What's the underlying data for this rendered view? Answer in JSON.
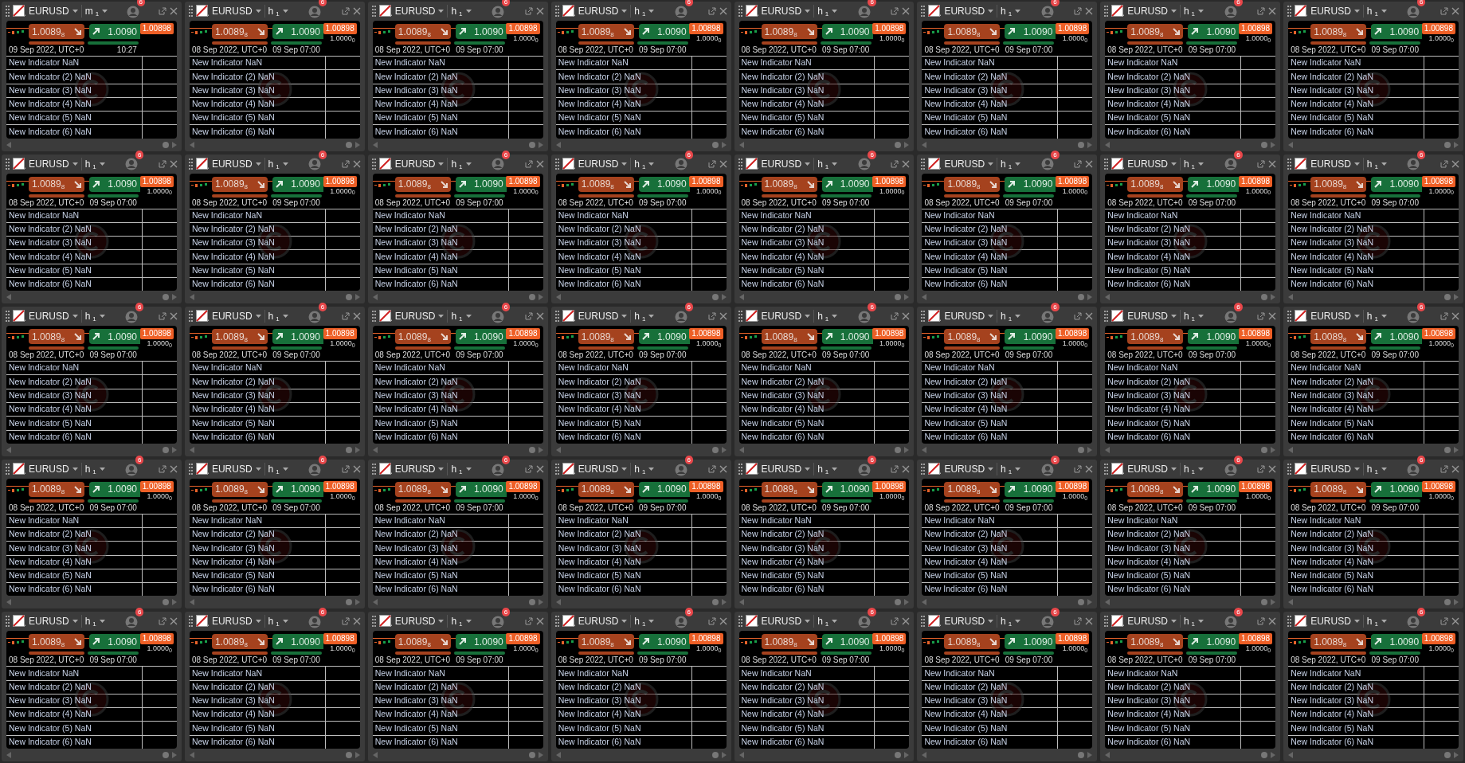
{
  "panels": [
    {
      "symbol": "EURUSD",
      "tf_unit": "m",
      "tf_count": "1",
      "alerts": "6",
      "sell": "1.0089$_{8}$",
      "buy": "1.0090",
      "price_tag": "1.00898",
      "date": "09 Sep 2022, UTC+0",
      "time": "10:27",
      "indicators": [
        "New Indicator NaN",
        "New Indicator (2) NaN",
        "New Indicator (3) NaN",
        "New Indicator (4) NaN",
        "New Indicator (5) NaN",
        "New Indicator (6) NaN"
      ]
    },
    {
      "symbol": "EURUSD",
      "tf_unit": "h",
      "tf_count": "1",
      "alerts": "6",
      "sell": "1.0089$_{8}$",
      "buy": "1.0090",
      "price_tag": "1.00898",
      "axis_label": "1.0000$_{0}$",
      "date": "08 Sep 2022, UTC+0",
      "time": "09 Sep 07:00",
      "indicators": [
        "New Indicator NaN",
        "New Indicator (2) NaN",
        "New Indicator (3) NaN",
        "New Indicator (4) NaN",
        "New Indicator (5) NaN",
        "New Indicator (6) NaN"
      ]
    },
    {
      "symbol": "EURUSD",
      "tf_unit": "h",
      "tf_count": "1",
      "alerts": "6",
      "sell": "1.0089$_{8}$",
      "buy": "1.0090",
      "price_tag": "1.00898",
      "axis_label": "1.0000$_{0}$",
      "date": "08 Sep 2022, UTC+0",
      "time": "09 Sep 07:00",
      "indicators": [
        "New Indicator NaN",
        "New Indicator (2) NaN",
        "New Indicator (3) NaN",
        "New Indicator (4) NaN",
        "New Indicator (5) NaN",
        "New Indicator (6) NaN"
      ]
    },
    {
      "symbol": "EURUSD",
      "tf_unit": "h",
      "tf_count": "1",
      "alerts": "6",
      "sell": "1.0089$_{8}$",
      "buy": "1.0090",
      "price_tag": "1.00898",
      "axis_label": "1.0000$_{0}$",
      "date": "08 Sep 2022, UTC+0",
      "time": "09 Sep 07:00",
      "indicators": [
        "New Indicator NaN",
        "New Indicator (2) NaN",
        "New Indicator (3) NaN",
        "New Indicator (4) NaN",
        "New Indicator (5) NaN",
        "New Indicator (6) NaN"
      ]
    },
    {
      "symbol": "EURUSD",
      "tf_unit": "h",
      "tf_count": "1",
      "alerts": "6",
      "sell": "1.0089$_{8}$",
      "buy": "1.0090",
      "price_tag": "1.00898",
      "axis_label": "1.0000$_{0}$",
      "date": "08 Sep 2022, UTC+0",
      "time": "09 Sep 07:00",
      "indicators": [
        "New Indicator NaN",
        "New Indicator (2) NaN",
        "New Indicator (3) NaN",
        "New Indicator (4) NaN",
        "New Indicator (5) NaN",
        "New Indicator (6) NaN"
      ]
    },
    {
      "symbol": "EURUSD",
      "tf_unit": "h",
      "tf_count": "1",
      "alerts": "6",
      "sell": "1.0089$_{8}$",
      "buy": "1.0090",
      "price_tag": "1.00898",
      "axis_label": "1.0000$_{0}$",
      "date": "08 Sep 2022, UTC+0",
      "time": "09 Sep 07:00",
      "indicators": [
        "New Indicator NaN",
        "New Indicator (2) NaN",
        "New Indicator (3) NaN",
        "New Indicator (4) NaN",
        "New Indicator (5) NaN",
        "New Indicator (6) NaN"
      ]
    },
    {
      "symbol": "EURUSD",
      "tf_unit": "h",
      "tf_count": "1",
      "alerts": "6",
      "sell": "1.0089$_{8}$",
      "buy": "1.0090",
      "price_tag": "1.00898",
      "axis_label": "1.0000$_{0}$",
      "date": "08 Sep 2022, UTC+0",
      "time": "09 Sep 07:00",
      "indicators": [
        "New Indicator NaN",
        "New Indicator (2) NaN",
        "New Indicator (3) NaN",
        "New Indicator (4) NaN",
        "New Indicator (5) NaN",
        "New Indicator (6) NaN"
      ]
    },
    {
      "symbol": "EURUSD",
      "tf_unit": "h",
      "tf_count": "1",
      "alerts": "6",
      "sell": "1.0089$_{8}$",
      "buy": "1.0090",
      "price_tag": "1.00898",
      "axis_label": "1.0000$_{0}$",
      "date": "08 Sep 2022, UTC+0",
      "time": "09 Sep 07:00",
      "indicators": [
        "New Indicator NaN",
        "New Indicator (2) NaN",
        "New Indicator (3) NaN",
        "New Indicator (4) NaN",
        "New Indicator (5) NaN",
        "New Indicator (6) NaN"
      ]
    },
    {
      "symbol": "EURUSD",
      "tf_unit": "h",
      "tf_count": "1",
      "alerts": "6",
      "sell": "1.0089$_{8}$",
      "buy": "1.0090",
      "price_tag": "1.00898",
      "axis_label": "1.0000$_{0}$",
      "date": "08 Sep 2022, UTC+0",
      "time": "09 Sep 07:00",
      "indicators": [
        "New Indicator NaN",
        "New Indicator (2) NaN",
        "New Indicator (3) NaN",
        "New Indicator (4) NaN",
        "New Indicator (5) NaN",
        "New Indicator (6) NaN"
      ]
    },
    {
      "symbol": "EURUSD",
      "tf_unit": "h",
      "tf_count": "1",
      "alerts": "6",
      "sell": "1.0089$_{8}$",
      "buy": "1.0090",
      "price_tag": "1.00898",
      "axis_label": "1.0000$_{0}$",
      "date": "08 Sep 2022, UTC+0",
      "time": "09 Sep 07:00",
      "indicators": [
        "New Indicator NaN",
        "New Indicator (2) NaN",
        "New Indicator (3) NaN",
        "New Indicator (4) NaN",
        "New Indicator (5) NaN",
        "New Indicator (6) NaN"
      ]
    },
    {
      "symbol": "EURUSD",
      "tf_unit": "h",
      "tf_count": "1",
      "alerts": "6",
      "sell": "1.0089$_{8}$",
      "buy": "1.0090",
      "price_tag": "1.00898",
      "axis_label": "1.0000$_{0}$",
      "date": "08 Sep 2022, UTC+0",
      "time": "09 Sep 07:00",
      "indicators": [
        "New Indicator NaN",
        "New Indicator (2) NaN",
        "New Indicator (3) NaN",
        "New Indicator (4) NaN",
        "New Indicator (5) NaN",
        "New Indicator (6) NaN"
      ]
    },
    {
      "symbol": "EURUSD",
      "tf_unit": "h",
      "tf_count": "1",
      "alerts": "6",
      "sell": "1.0089$_{8}$",
      "buy": "1.0090",
      "price_tag": "1.00898",
      "axis_label": "1.0000$_{0}$",
      "date": "08 Sep 2022, UTC+0",
      "time": "09 Sep 07:00",
      "indicators": [
        "New Indicator NaN",
        "New Indicator (2) NaN",
        "New Indicator (3) NaN",
        "New Indicator (4) NaN",
        "New Indicator (5) NaN",
        "New Indicator (6) NaN"
      ]
    },
    {
      "symbol": "EURUSD",
      "tf_unit": "h",
      "tf_count": "1",
      "alerts": "6",
      "sell": "1.0089$_{8}$",
      "buy": "1.0090",
      "price_tag": "1.00898",
      "axis_label": "1.0000$_{0}$",
      "date": "08 Sep 2022, UTC+0",
      "time": "09 Sep 07:00",
      "indicators": [
        "New Indicator NaN",
        "New Indicator (2) NaN",
        "New Indicator (3) NaN",
        "New Indicator (4) NaN",
        "New Indicator (5) NaN",
        "New Indicator (6) NaN"
      ]
    },
    {
      "symbol": "EURUSD",
      "tf_unit": "h",
      "tf_count": "1",
      "alerts": "6",
      "sell": "1.0089$_{8}$",
      "buy": "1.0090",
      "price_tag": "1.00898",
      "axis_label": "1.0000$_{0}$",
      "date": "08 Sep 2022, UTC+0",
      "time": "09 Sep 07:00",
      "indicators": [
        "New Indicator NaN",
        "New Indicator (2) NaN",
        "New Indicator (3) NaN",
        "New Indicator (4) NaN",
        "New Indicator (5) NaN",
        "New Indicator (6) NaN"
      ]
    },
    {
      "symbol": "EURUSD",
      "tf_unit": "h",
      "tf_count": "1",
      "alerts": "6",
      "sell": "1.0089$_{8}$",
      "buy": "1.0090",
      "price_tag": "1.00898",
      "axis_label": "1.0000$_{0}$",
      "date": "08 Sep 2022, UTC+0",
      "time": "09 Sep 07:00",
      "indicators": [
        "New Indicator NaN",
        "New Indicator (2) NaN",
        "New Indicator (3) NaN",
        "New Indicator (4) NaN",
        "New Indicator (5) NaN",
        "New Indicator (6) NaN"
      ]
    },
    {
      "symbol": "EURUSD",
      "tf_unit": "h",
      "tf_count": "1",
      "alerts": "6",
      "sell": "1.0089$_{8}$",
      "buy": "1.0090",
      "price_tag": "1.00898",
      "axis_label": "1.0000$_{0}$",
      "date": "08 Sep 2022, UTC+0",
      "time": "09 Sep 07:00",
      "indicators": [
        "New Indicator NaN",
        "New Indicator (2) NaN",
        "New Indicator (3) NaN",
        "New Indicator (4) NaN",
        "New Indicator (5) NaN",
        "New Indicator (6) NaN"
      ]
    },
    {
      "symbol": "EURUSD",
      "tf_unit": "h",
      "tf_count": "1",
      "alerts": "6",
      "sell": "1.0089$_{8}$",
      "buy": "1.0090",
      "price_tag": "1.00898",
      "axis_label": "1.0000$_{0}$",
      "date": "08 Sep 2022, UTC+0",
      "time": "09 Sep 07:00",
      "indicators": [
        "New Indicator NaN",
        "New Indicator (2) NaN",
        "New Indicator (3) NaN",
        "New Indicator (4) NaN",
        "New Indicator (5) NaN",
        "New Indicator (6) NaN"
      ]
    },
    {
      "symbol": "EURUSD",
      "tf_unit": "h",
      "tf_count": "1",
      "alerts": "6",
      "sell": "1.0089$_{8}$",
      "buy": "1.0090",
      "price_tag": "1.00898",
      "axis_label": "1.0000$_{0}$",
      "date": "08 Sep 2022, UTC+0",
      "time": "09 Sep 07:00",
      "indicators": [
        "New Indicator NaN",
        "New Indicator (2) NaN",
        "New Indicator (3) NaN",
        "New Indicator (4) NaN",
        "New Indicator (5) NaN",
        "New Indicator (6) NaN"
      ]
    },
    {
      "symbol": "EURUSD",
      "tf_unit": "h",
      "tf_count": "1",
      "alerts": "6",
      "sell": "1.0089$_{8}$",
      "buy": "1.0090",
      "price_tag": "1.00898",
      "axis_label": "1.0000$_{0}$",
      "date": "08 Sep 2022, UTC+0",
      "time": "09 Sep 07:00",
      "indicators": [
        "New Indicator NaN",
        "New Indicator (2) NaN",
        "New Indicator (3) NaN",
        "New Indicator (4) NaN",
        "New Indicator (5) NaN",
        "New Indicator (6) NaN"
      ]
    },
    {
      "symbol": "EURUSD",
      "tf_unit": "h",
      "tf_count": "1",
      "alerts": "6",
      "sell": "1.0089$_{8}$",
      "buy": "1.0090",
      "price_tag": "1.00898",
      "axis_label": "1.0000$_{0}$",
      "date": "08 Sep 2022, UTC+0",
      "time": "09 Sep 07:00",
      "indicators": [
        "New Indicator NaN",
        "New Indicator (2) NaN",
        "New Indicator (3) NaN",
        "New Indicator (4) NaN",
        "New Indicator (5) NaN",
        "New Indicator (6) NaN"
      ]
    },
    {
      "symbol": "EURUSD",
      "tf_unit": "h",
      "tf_count": "1",
      "alerts": "6",
      "sell": "1.0089$_{8}$",
      "buy": "1.0090",
      "price_tag": "1.00898",
      "axis_label": "1.0000$_{0}$",
      "date": "08 Sep 2022, UTC+0",
      "time": "09 Sep 07:00",
      "indicators": [
        "New Indicator NaN",
        "New Indicator (2) NaN",
        "New Indicator (3) NaN",
        "New Indicator (4) NaN",
        "New Indicator (5) NaN",
        "New Indicator (6) NaN"
      ]
    },
    {
      "symbol": "EURUSD",
      "tf_unit": "h",
      "tf_count": "1",
      "alerts": "6",
      "sell": "1.0089$_{8}$",
      "buy": "1.0090",
      "price_tag": "1.00898",
      "axis_label": "1.0000$_{0}$",
      "date": "08 Sep 2022, UTC+0",
      "time": "09 Sep 07:00",
      "indicators": [
        "New Indicator NaN",
        "New Indicator (2) NaN",
        "New Indicator (3) NaN",
        "New Indicator (4) NaN",
        "New Indicator (5) NaN",
        "New Indicator (6) NaN"
      ]
    },
    {
      "symbol": "EURUSD",
      "tf_unit": "h",
      "tf_count": "1",
      "alerts": "6",
      "sell": "1.0089$_{8}$",
      "buy": "1.0090",
      "price_tag": "1.00898",
      "axis_label": "1.0000$_{0}$",
      "date": "08 Sep 2022, UTC+0",
      "time": "09 Sep 07:00",
      "indicators": [
        "New Indicator NaN",
        "New Indicator (2) NaN",
        "New Indicator (3) NaN",
        "New Indicator (4) NaN",
        "New Indicator (5) NaN",
        "New Indicator (6) NaN"
      ]
    },
    {
      "symbol": "EURUSD",
      "tf_unit": "h",
      "tf_count": "1",
      "alerts": "6",
      "sell": "1.0089$_{8}$",
      "buy": "1.0090",
      "price_tag": "1.00898",
      "axis_label": "1.0000$_{0}$",
      "date": "08 Sep 2022, UTC+0",
      "time": "09 Sep 07:00",
      "indicators": [
        "New Indicator NaN",
        "New Indicator (2) NaN",
        "New Indicator (3) NaN",
        "New Indicator (4) NaN",
        "New Indicator (5) NaN",
        "New Indicator (6) NaN"
      ]
    },
    {
      "symbol": "EURUSD",
      "tf_unit": "h",
      "tf_count": "1",
      "alerts": "6",
      "sell": "1.0089$_{8}$",
      "buy": "1.0090",
      "price_tag": "1.00898",
      "axis_label": "1.0000$_{0}$",
      "date": "08 Sep 2022, UTC+0",
      "time": "09 Sep 07:00",
      "indicators": [
        "New Indicator NaN",
        "New Indicator (2) NaN",
        "New Indicator (3) NaN",
        "New Indicator (4) NaN",
        "New Indicator (5) NaN",
        "New Indicator (6) NaN"
      ]
    },
    {
      "symbol": "EURUSD",
      "tf_unit": "h",
      "tf_count": "1",
      "alerts": "6",
      "sell": "1.0089$_{8}$",
      "buy": "1.0090",
      "price_tag": "1.00898",
      "axis_label": "1.0000$_{0}$",
      "date": "08 Sep 2022, UTC+0",
      "time": "09 Sep 07:00",
      "indicators": [
        "New Indicator NaN",
        "New Indicator (2) NaN",
        "New Indicator (3) NaN",
        "New Indicator (4) NaN",
        "New Indicator (5) NaN",
        "New Indicator (6) NaN"
      ]
    },
    {
      "symbol": "EURUSD",
      "tf_unit": "h",
      "tf_count": "1",
      "alerts": "6",
      "sell": "1.0089$_{8}$",
      "buy": "1.0090",
      "price_tag": "1.00898",
      "axis_label": "1.0000$_{0}$",
      "date": "08 Sep 2022, UTC+0",
      "time": "09 Sep 07:00",
      "indicators": [
        "New Indicator NaN",
        "New Indicator (2) NaN",
        "New Indicator (3) NaN",
        "New Indicator (4) NaN",
        "New Indicator (5) NaN",
        "New Indicator (6) NaN"
      ]
    },
    {
      "symbol": "EURUSD",
      "tf_unit": "h",
      "tf_count": "1",
      "alerts": "6",
      "sell": "1.0089$_{8}$",
      "buy": "1.0090",
      "price_tag": "1.00898",
      "axis_label": "1.0000$_{0}$",
      "date": "08 Sep 2022, UTC+0",
      "time": "09 Sep 07:00",
      "indicators": [
        "New Indicator NaN",
        "New Indicator (2) NaN",
        "New Indicator (3) NaN",
        "New Indicator (4) NaN",
        "New Indicator (5) NaN",
        "New Indicator (6) NaN"
      ]
    },
    {
      "symbol": "EURUSD",
      "tf_unit": "h",
      "tf_count": "1",
      "alerts": "6",
      "sell": "1.0089$_{8}$",
      "buy": "1.0090",
      "price_tag": "1.00898",
      "axis_label": "1.0000$_{0}$",
      "date": "08 Sep 2022, UTC+0",
      "time": "09 Sep 07:00",
      "indicators": [
        "New Indicator NaN",
        "New Indicator (2) NaN",
        "New Indicator (3) NaN",
        "New Indicator (4) NaN",
        "New Indicator (5) NaN",
        "New Indicator (6) NaN"
      ]
    },
    {
      "symbol": "EURUSD",
      "tf_unit": "h",
      "tf_count": "1",
      "alerts": "6",
      "sell": "1.0089$_{8}$",
      "buy": "1.0090",
      "price_tag": "1.00898",
      "axis_label": "1.0000$_{0}$",
      "date": "08 Sep 2022, UTC+0",
      "time": "09 Sep 07:00",
      "indicators": [
        "New Indicator NaN",
        "New Indicator (2) NaN",
        "New Indicator (3) NaN",
        "New Indicator (4) NaN",
        "New Indicator (5) NaN",
        "New Indicator (6) NaN"
      ]
    },
    {
      "symbol": "EURUSD",
      "tf_unit": "h",
      "tf_count": "1",
      "alerts": "6",
      "sell": "1.0089$_{8}$",
      "buy": "1.0090",
      "price_tag": "1.00898",
      "axis_label": "1.0000$_{0}$",
      "date": "08 Sep 2022, UTC+0",
      "time": "09 Sep 07:00",
      "indicators": [
        "New Indicator NaN",
        "New Indicator (2) NaN",
        "New Indicator (3) NaN",
        "New Indicator (4) NaN",
        "New Indicator (5) NaN",
        "New Indicator (6) NaN"
      ]
    },
    {
      "symbol": "EURUSD",
      "tf_unit": "h",
      "tf_count": "1",
      "alerts": "6",
      "sell": "1.0089$_{8}$",
      "buy": "1.0090",
      "price_tag": "1.00898",
      "axis_label": "1.0000$_{0}$",
      "date": "08 Sep 2022, UTC+0",
      "time": "09 Sep 07:00",
      "indicators": [
        "New Indicator NaN",
        "New Indicator (2) NaN",
        "New Indicator (3) NaN",
        "New Indicator (4) NaN",
        "New Indicator (5) NaN",
        "New Indicator (6) NaN"
      ]
    },
    {
      "symbol": "EURUSD",
      "tf_unit": "h",
      "tf_count": "1",
      "alerts": "6",
      "sell": "1.0089$_{8}$",
      "buy": "1.0090",
      "price_tag": "1.00898",
      "axis_label": "1.0000$_{0}$",
      "date": "08 Sep 2022, UTC+0",
      "time": "09 Sep 07:00",
      "indicators": [
        "New Indicator NaN",
        "New Indicator (2) NaN",
        "New Indicator (3) NaN",
        "New Indicator (4) NaN",
        "New Indicator (5) NaN",
        "New Indicator (6) NaN"
      ]
    },
    {
      "symbol": "EURUSD",
      "tf_unit": "h",
      "tf_count": "1",
      "alerts": "6",
      "sell": "1.0089$_{8}$",
      "buy": "1.0090",
      "price_tag": "1.00898",
      "axis_label": "1.0000$_{0}$",
      "date": "08 Sep 2022, UTC+0",
      "time": "09 Sep 07:00",
      "indicators": [
        "New Indicator NaN",
        "New Indicator (2) NaN",
        "New Indicator (3) NaN",
        "New Indicator (4) NaN",
        "New Indicator (5) NaN",
        "New Indicator (6) NaN"
      ]
    },
    {
      "symbol": "EURUSD",
      "tf_unit": "h",
      "tf_count": "1",
      "alerts": "6",
      "sell": "1.0089$_{8}$",
      "buy": "1.0090",
      "price_tag": "1.00898",
      "axis_label": "1.0000$_{0}$",
      "date": "08 Sep 2022, UTC+0",
      "time": "09 Sep 07:00",
      "indicators": [
        "New Indicator NaN",
        "New Indicator (2) NaN",
        "New Indicator (3) NaN",
        "New Indicator (4) NaN",
        "New Indicator (5) NaN",
        "New Indicator (6) NaN"
      ]
    },
    {
      "symbol": "EURUSD",
      "tf_unit": "h",
      "tf_count": "1",
      "alerts": "6",
      "sell": "1.0089$_{8}$",
      "buy": "1.0090",
      "price_tag": "1.00898",
      "axis_label": "1.0000$_{0}$",
      "date": "08 Sep 2022, UTC+0",
      "time": "09 Sep 07:00",
      "indicators": [
        "New Indicator NaN",
        "New Indicator (2) NaN",
        "New Indicator (3) NaN",
        "New Indicator (4) NaN",
        "New Indicator (5) NaN",
        "New Indicator (6) NaN"
      ]
    },
    {
      "symbol": "EURUSD",
      "tf_unit": "h",
      "tf_count": "1",
      "alerts": "6",
      "sell": "1.0089$_{8}$",
      "buy": "1.0090",
      "price_tag": "1.00898",
      "axis_label": "1.0000$_{0}$",
      "date": "08 Sep 2022, UTC+0",
      "time": "09 Sep 07:00",
      "indicators": [
        "New Indicator NaN",
        "New Indicator (2) NaN",
        "New Indicator (3) NaN",
        "New Indicator (4) NaN",
        "New Indicator (5) NaN",
        "New Indicator (6) NaN"
      ]
    },
    {
      "symbol": "EURUSD",
      "tf_unit": "h",
      "tf_count": "1",
      "alerts": "6",
      "sell": "1.0089$_{8}$",
      "buy": "1.0090",
      "price_tag": "1.00898",
      "axis_label": "1.0000$_{0}$",
      "date": "08 Sep 2022, UTC+0",
      "time": "09 Sep 07:00",
      "indicators": [
        "New Indicator NaN",
        "New Indicator (2) NaN",
        "New Indicator (3) NaN",
        "New Indicator (4) NaN",
        "New Indicator (5) NaN",
        "New Indicator (6) NaN"
      ]
    },
    {
      "symbol": "EURUSD",
      "tf_unit": "h",
      "tf_count": "1",
      "alerts": "6",
      "sell": "1.0089$_{8}$",
      "buy": "1.0090",
      "price_tag": "1.00898",
      "axis_label": "1.0000$_{0}$",
      "date": "08 Sep 2022, UTC+0",
      "time": "09 Sep 07:00",
      "indicators": [
        "New Indicator NaN",
        "New Indicator (2) NaN",
        "New Indicator (3) NaN",
        "New Indicator (4) NaN",
        "New Indicator (5) NaN",
        "New Indicator (6) NaN"
      ]
    },
    {
      "symbol": "EURUSD",
      "tf_unit": "h",
      "tf_count": "1",
      "alerts": "6",
      "sell": "1.0089$_{8}$",
      "buy": "1.0090",
      "price_tag": "1.00898",
      "axis_label": "1.0000$_{0}$",
      "date": "08 Sep 2022, UTC+0",
      "time": "09 Sep 07:00",
      "indicators": [
        "New Indicator NaN",
        "New Indicator (2) NaN",
        "New Indicator (3) NaN",
        "New Indicator (4) NaN",
        "New Indicator (5) NaN",
        "New Indicator (6) NaN"
      ]
    }
  ]
}
